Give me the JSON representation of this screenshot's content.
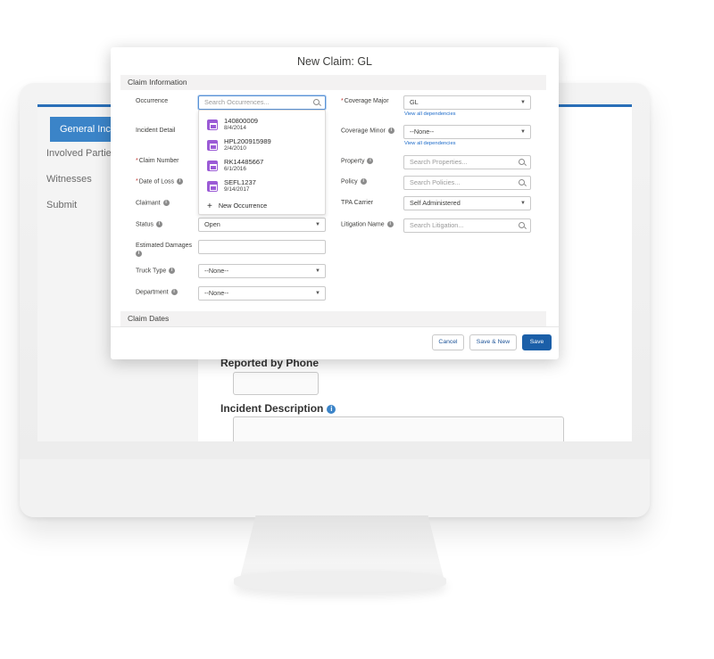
{
  "background_app": {
    "nav": {
      "active_item": "General Incident",
      "items": [
        "Involved Parties",
        "Witnesses",
        "Submit"
      ]
    },
    "labels": {
      "reported_by_phone": "Reported by Phone",
      "incident_description": "Incident Description"
    }
  },
  "modal": {
    "title": "New Claim: GL",
    "sections": {
      "claim_information": "Claim Information",
      "claim_dates": "Claim Dates"
    },
    "left": {
      "occurrence": {
        "label": "Occurrence",
        "placeholder": "Search Occurrences..."
      },
      "incident_detail": {
        "label": "Incident Detail"
      },
      "claim_number": {
        "label": "Claim Number",
        "required": "*"
      },
      "date_of_loss": {
        "label": "Date of Loss",
        "required": "*"
      },
      "claimant": {
        "label": "Claimant"
      },
      "status": {
        "label": "Status",
        "value": "Open"
      },
      "estimated_damages": {
        "label": "Estimated Damages",
        "value": ""
      },
      "truck_type": {
        "label": "Truck Type",
        "value": "--None--"
      },
      "department": {
        "label": "Department",
        "value": "--None--"
      }
    },
    "right": {
      "coverage_major": {
        "label": "Coverage Major",
        "required": "*",
        "value": "GL",
        "link": "View all dependencies"
      },
      "coverage_minor": {
        "label": "Coverage Minor",
        "value": "--None--",
        "link": "View all dependencies"
      },
      "property": {
        "label": "Property",
        "placeholder": "Search Properties..."
      },
      "policy": {
        "label": "Policy",
        "placeholder": "Search Policies..."
      },
      "tpa_carrier": {
        "label": "TPA Carrier",
        "value": "Self Administered"
      },
      "litigation_name": {
        "label": "Litigation Name",
        "placeholder": "Search Litigation..."
      }
    },
    "occurrence_dropdown": {
      "items": [
        {
          "id": "140800009",
          "date": "8/4/2014"
        },
        {
          "id": "HPL200915989",
          "date": "2/4/2010"
        },
        {
          "id": "RK14485667",
          "date": "6/1/2016"
        },
        {
          "id": "SEFL1237",
          "date": "9/14/2017"
        }
      ],
      "new_label": "New Occurrence",
      "new_symbol": "+"
    },
    "buttons": {
      "cancel": "Cancel",
      "save_new": "Save & New",
      "save": "Save"
    }
  },
  "colors": {
    "accent": "#1b5fa8",
    "nav_active": "#3b84c8",
    "record_icon": "#9b5bd6",
    "required": "#c23934",
    "link": "#1b6ac9"
  },
  "icons": [
    "search-icon",
    "chevron-down-icon",
    "info-icon",
    "record-icon",
    "plus-icon"
  ]
}
